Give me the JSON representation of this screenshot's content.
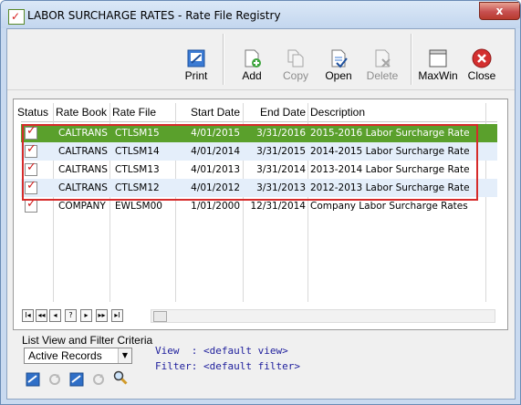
{
  "window": {
    "title": "LABOR SURCHARGE RATES - Rate File Registry",
    "close_glyph": "x"
  },
  "toolbar": {
    "print": "Print",
    "add": "Add",
    "copy": "Copy",
    "open": "Open",
    "delete": "Delete",
    "maxwin": "MaxWin",
    "close": "Close"
  },
  "grid": {
    "columns": [
      "Status",
      "Rate Book",
      "Rate File",
      "Start Date",
      "End Date",
      "Description"
    ],
    "rows": [
      {
        "status": "checked",
        "rate_book": "CALTRANS",
        "rate_file": "CTLSM15",
        "start_date": "4/01/2015",
        "end_date": "3/31/2016",
        "description": "2015-2016 Labor Surcharge Rate",
        "state": "selected"
      },
      {
        "status": "checked",
        "rate_book": "CALTRANS",
        "rate_file": "CTLSM14",
        "start_date": "4/01/2014",
        "end_date": "3/31/2015",
        "description": "2014-2015 Labor Surcharge Rate",
        "state": "alt"
      },
      {
        "status": "checked",
        "rate_book": "CALTRANS",
        "rate_file": "CTLSM13",
        "start_date": "4/01/2013",
        "end_date": "3/31/2014",
        "description": "2013-2014 Labor Surcharge Rate",
        "state": "normal"
      },
      {
        "status": "checked",
        "rate_book": "CALTRANS",
        "rate_file": "CTLSM12",
        "start_date": "4/01/2012",
        "end_date": "3/31/2013",
        "description": "2012-2013 Labor Surcharge Rate",
        "state": "alt"
      },
      {
        "status": "checked",
        "rate_book": "COMPANY",
        "rate_file": "EWLSM00",
        "start_date": "1/01/2000",
        "end_date": "12/31/2014",
        "description": "Company Labor Surcharge Rates",
        "state": "normal"
      }
    ],
    "nav_buttons": [
      "I◂",
      "◂◂",
      "◂",
      "?",
      "▸",
      "▸▸",
      "▸I"
    ]
  },
  "filter": {
    "label": "List View and Filter Criteria",
    "selected": "Active Records",
    "view_line": "View  : <default view>",
    "filter_line": "Filter: <default filter>"
  },
  "colors": {
    "selected_row": "#5aa02c",
    "alt_row": "#e4eefa",
    "highlight_box": "#d62b2b"
  }
}
